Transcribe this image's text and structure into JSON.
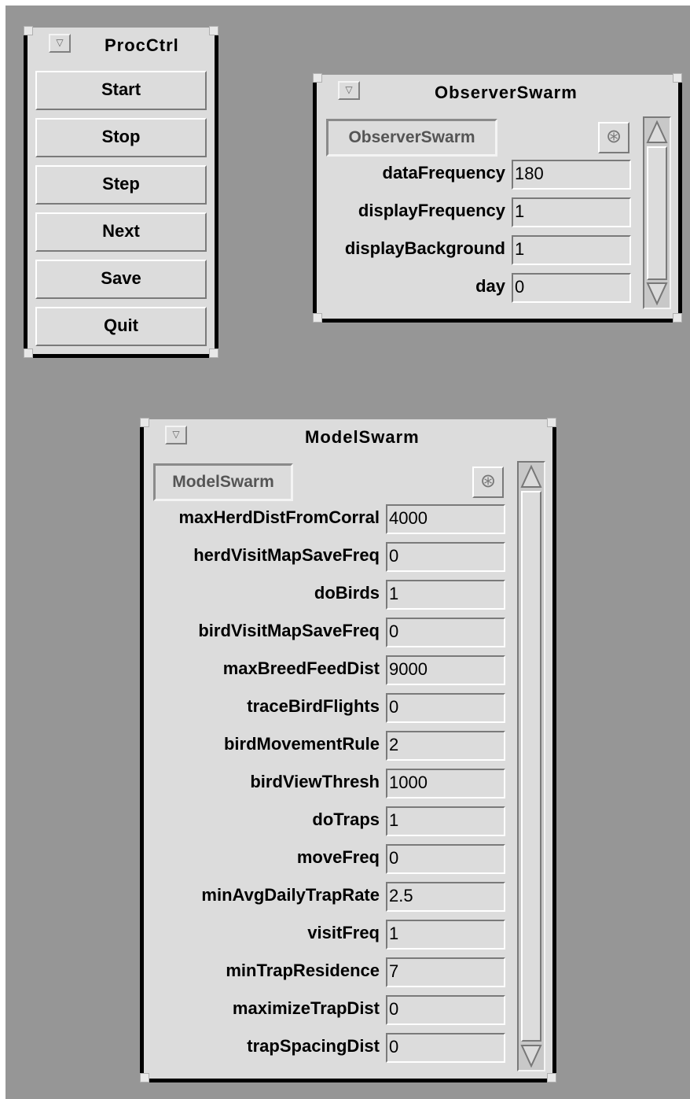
{
  "proc_ctrl": {
    "title": "ProcCtrl",
    "menu_glyph": "▽",
    "buttons": [
      "Start",
      "Stop",
      "Step",
      "Next",
      "Save",
      "Quit"
    ]
  },
  "observer_swarm": {
    "title": "ObserverSwarm",
    "menu_glyph": "▽",
    "object_button": "ObserverSwarm",
    "icon_glyph": "⊛",
    "fields": [
      {
        "label": "dataFrequency",
        "value": "180"
      },
      {
        "label": "displayFrequency",
        "value": "1"
      },
      {
        "label": "displayBackground",
        "value": "1"
      },
      {
        "label": "day",
        "value": "0"
      }
    ]
  },
  "model_swarm": {
    "title": "ModelSwarm",
    "menu_glyph": "▽",
    "object_button": "ModelSwarm",
    "icon_glyph": "⊛",
    "fields": [
      {
        "label": "maxHerdDistFromCorral",
        "value": "4000"
      },
      {
        "label": "herdVisitMapSaveFreq",
        "value": "0"
      },
      {
        "label": "doBirds",
        "value": "1"
      },
      {
        "label": "birdVisitMapSaveFreq",
        "value": "0"
      },
      {
        "label": "maxBreedFeedDist",
        "value": "9000"
      },
      {
        "label": "traceBirdFlights",
        "value": "0"
      },
      {
        "label": "birdMovementRule",
        "value": "2"
      },
      {
        "label": "birdViewThresh",
        "value": "1000"
      },
      {
        "label": "doTraps",
        "value": "1"
      },
      {
        "label": "moveFreq",
        "value": "0"
      },
      {
        "label": "minAvgDailyTrapRate",
        "value": "2.5"
      },
      {
        "label": "visitFreq",
        "value": "1"
      },
      {
        "label": "minTrapResidence",
        "value": "7"
      },
      {
        "label": "maximizeTrapDist",
        "value": "0"
      },
      {
        "label": "trapSpacingDist",
        "value": "0"
      }
    ]
  },
  "icons": [
    "menu-triangle-icon",
    "probe-icon",
    "scroll-up-arrow-icon",
    "scroll-down-arrow-icon"
  ]
}
